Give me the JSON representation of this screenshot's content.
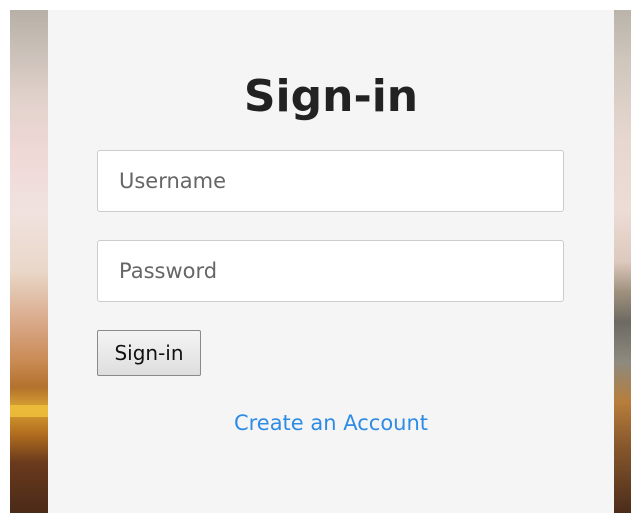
{
  "form": {
    "title": "Sign-in",
    "username": {
      "placeholder": "Username",
      "value": ""
    },
    "password": {
      "placeholder": "Password",
      "value": ""
    },
    "submit_label": "Sign-in",
    "create_account_link": "Create an Account"
  },
  "colors": {
    "panel_background": "#f5f5f5",
    "link": "#2f8ce6",
    "title_text": "#222222"
  }
}
